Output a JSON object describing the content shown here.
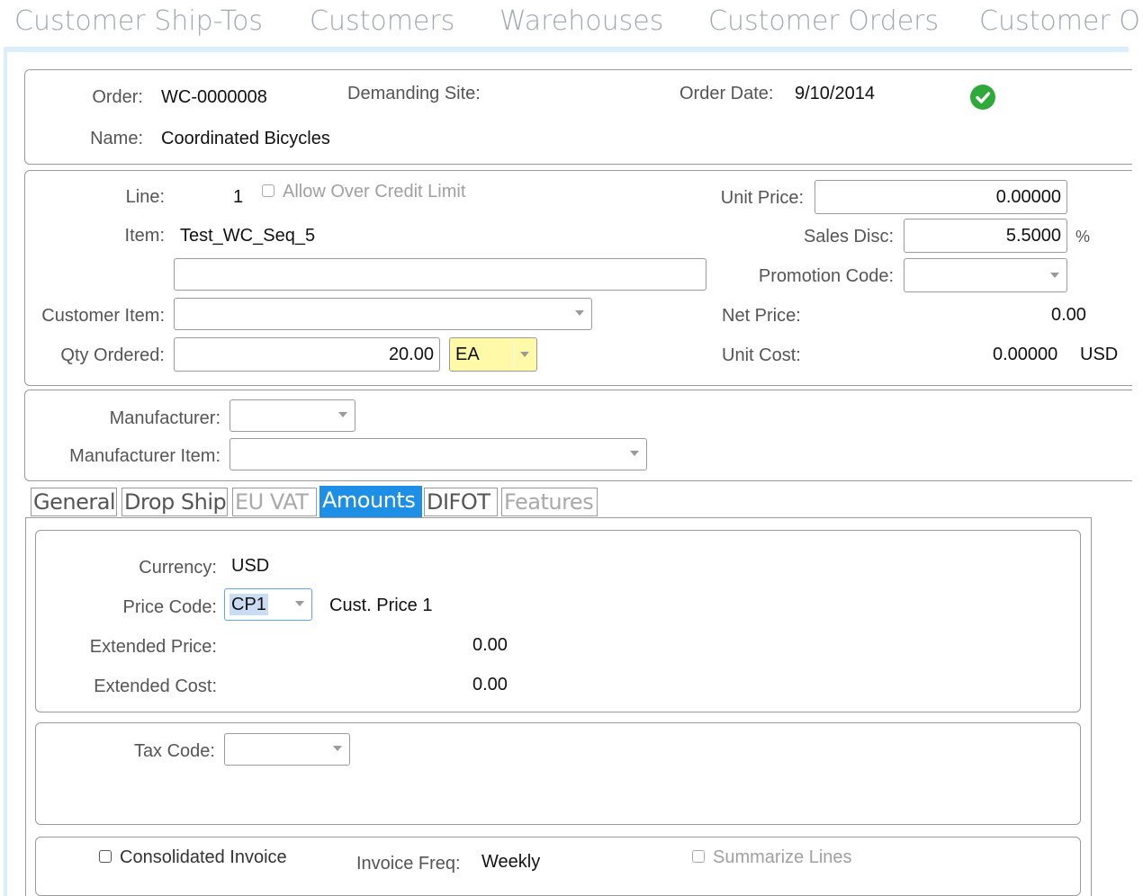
{
  "nav": {
    "tabs": [
      "Customer Ship-Tos",
      "Customers",
      "Warehouses",
      "Customer Orders",
      "Customer O"
    ]
  },
  "header": {
    "order_label": "Order:",
    "order_value": "WC-0000008",
    "demanding_site_label": "Demanding Site:",
    "order_date_label": "Order Date:",
    "order_date_value": "9/10/2014",
    "name_label": "Name:",
    "name_value": "Coordinated Bicycles",
    "status_icon": "check-circle-icon"
  },
  "line": {
    "line_label": "Line:",
    "line_value": "1",
    "allow_over_credit_label": "Allow Over Credit Limit",
    "item_label": "Item:",
    "item_value": "Test_WC_Seq_5",
    "item_description": "",
    "customer_item_label": "Customer Item:",
    "customer_item_value": "",
    "qty_ordered_label": "Qty Ordered:",
    "qty_ordered_value": "20.00",
    "uom_value": "EA",
    "unit_price_label": "Unit Price:",
    "unit_price_value": "0.00000",
    "sales_disc_label": "Sales Disc:",
    "sales_disc_value": "5.5000",
    "percent_sign": "%",
    "promotion_code_label": "Promotion Code:",
    "promotion_code_value": "",
    "net_price_label": "Net Price:",
    "net_price_value": "0.00",
    "unit_cost_label": "Unit Cost:",
    "unit_cost_value": "0.00000",
    "unit_cost_currency": "USD"
  },
  "manufacturer": {
    "manufacturer_label": "Manufacturer:",
    "manufacturer_value": "",
    "manufacturer_item_label": "Manufacturer Item:",
    "manufacturer_item_value": ""
  },
  "tabs": {
    "general": "General",
    "drop_ship": "Drop Ship",
    "eu_vat": "EU VAT",
    "amounts": "Amounts",
    "difot": "DIFOT",
    "features": "Features"
  },
  "amounts": {
    "currency_label": "Currency:",
    "currency_value": "USD",
    "price_code_label": "Price Code:",
    "price_code_value": "CP1",
    "price_code_description": "Cust. Price 1",
    "extended_price_label": "Extended Price:",
    "extended_price_value": "0.00",
    "extended_cost_label": "Extended Cost:",
    "extended_cost_value": "0.00",
    "tax_code_label": "Tax Code:",
    "tax_code_value": "",
    "consolidated_invoice_label": "Consolidated Invoice",
    "invoice_freq_label": "Invoice Freq:",
    "invoice_freq_value": "Weekly",
    "summarize_lines_label": "Summarize Lines"
  }
}
